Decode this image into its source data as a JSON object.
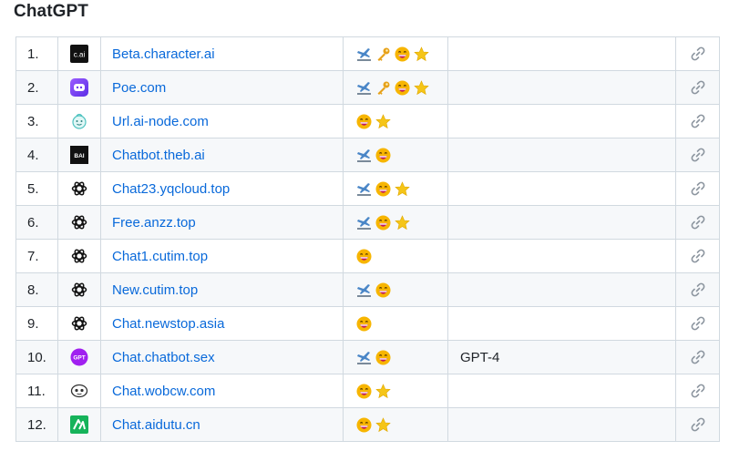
{
  "section": {
    "title": "ChatGPT"
  },
  "rows": [
    {
      "num": "1.",
      "logo": "cai-logo-icon",
      "site": "Beta.character.ai",
      "features": [
        "plane-icon",
        "key-icon",
        "grinning-face-icon",
        "star-icon"
      ],
      "note": ""
    },
    {
      "num": "2.",
      "logo": "poe-logo-icon",
      "site": "Poe.com",
      "features": [
        "plane-icon",
        "key-icon",
        "grinning-face-icon",
        "star-icon"
      ],
      "note": ""
    },
    {
      "num": "3.",
      "logo": "ai-node-logo-icon",
      "site": "Url.ai-node.com",
      "features": [
        "grinning-face-icon",
        "star-icon"
      ],
      "note": ""
    },
    {
      "num": "4.",
      "logo": "theb-ai-logo-icon",
      "site": "Chatbot.theb.ai",
      "features": [
        "plane-icon",
        "grinning-face-icon"
      ],
      "note": ""
    },
    {
      "num": "5.",
      "logo": "openai-logo-icon",
      "site": "Chat23.yqcloud.top",
      "features": [
        "plane-icon",
        "grinning-face-icon",
        "star-icon"
      ],
      "note": ""
    },
    {
      "num": "6.",
      "logo": "openai-logo-icon",
      "site": "Free.anzz.top",
      "features": [
        "plane-icon",
        "grinning-face-icon",
        "star-icon"
      ],
      "note": ""
    },
    {
      "num": "7.",
      "logo": "openai-logo-icon",
      "site": "Chat1.cutim.top",
      "features": [
        "grinning-face-icon"
      ],
      "note": ""
    },
    {
      "num": "8.",
      "logo": "openai-logo-icon",
      "site": "New.cutim.top",
      "features": [
        "plane-icon",
        "grinning-face-icon"
      ],
      "note": ""
    },
    {
      "num": "9.",
      "logo": "openai-logo-icon",
      "site": "Chat.newstop.asia",
      "features": [
        "grinning-face-icon"
      ],
      "note": ""
    },
    {
      "num": "10.",
      "logo": "gpt-badge-logo-icon",
      "site": "Chat.chatbot.sex",
      "features": [
        "plane-icon",
        "grinning-face-icon"
      ],
      "note": "GPT-4"
    },
    {
      "num": "11.",
      "logo": "wobcw-logo-icon",
      "site": "Chat.wobcw.com",
      "features": [
        "grinning-face-icon",
        "star-icon"
      ],
      "note": ""
    },
    {
      "num": "12.",
      "logo": "aidutu-logo-icon",
      "site": "Chat.aidutu.cn",
      "features": [
        "grinning-face-icon",
        "star-icon"
      ],
      "note": ""
    }
  ],
  "colors": {
    "link": "#0969da",
    "border": "#d1d9e0",
    "stripe": "#f6f8fa",
    "star": "#f5c518",
    "face": "#f7b500"
  }
}
